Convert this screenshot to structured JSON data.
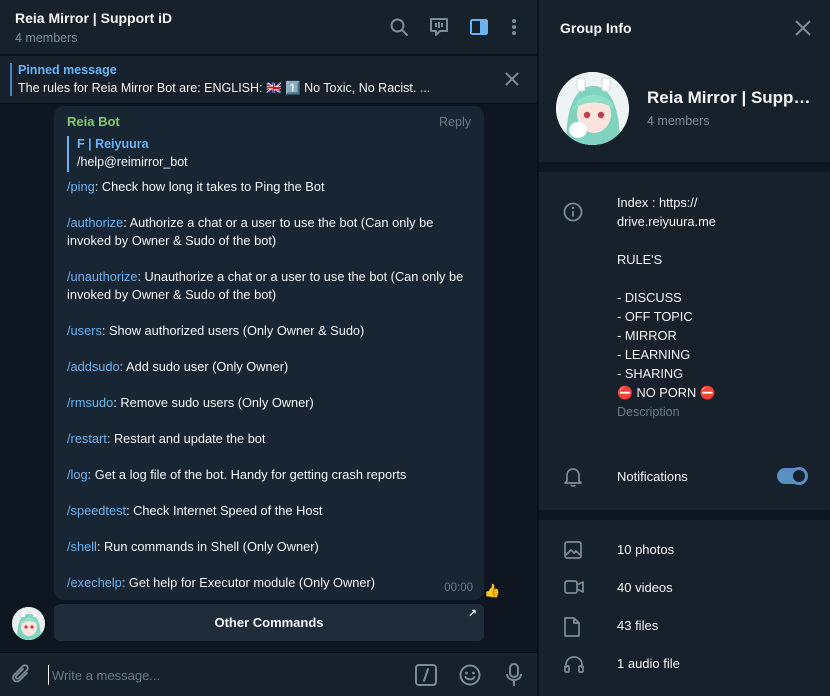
{
  "chat": {
    "title": "Reia Mirror | Support iD",
    "subtitle": "4 members",
    "header_icons": [
      "search-icon",
      "video-chat-icon",
      "sidebar-toggle-icon",
      "more-vert-icon"
    ]
  },
  "pinned": {
    "title": "Pinned message",
    "text": "The rules for Reia Mirror Bot are:  ENGLISH: 🇬🇧  1️⃣ No Toxic, No Racist.  ..."
  },
  "message": {
    "sender": "Reia Bot",
    "reply_label": "Reply",
    "quote_name": "F | Reiyuura",
    "quote_text": "/help@reimirror_bot",
    "commands": [
      {
        "cmd": "/ping",
        "desc": ": Check how long it takes to Ping the Bot"
      },
      {
        "cmd": "/authorize",
        "desc": ": Authorize a chat or a user to use the bot (Can only be invoked by Owner & Sudo of the bot)"
      },
      {
        "cmd": "/unauthorize",
        "desc": ": Unauthorize a chat or a user to use the bot (Can only be invoked by Owner & Sudo of the bot)"
      },
      {
        "cmd": "/users",
        "desc": ": Show authorized users (Only Owner & Sudo)"
      },
      {
        "cmd": "/addsudo",
        "desc": ": Add sudo user (Only Owner)"
      },
      {
        "cmd": "/rmsudo",
        "desc": ": Remove sudo users (Only Owner)"
      },
      {
        "cmd": "/restart",
        "desc": ": Restart and update the bot"
      },
      {
        "cmd": "/log",
        "desc": ": Get a log file of the bot. Handy for getting crash reports"
      },
      {
        "cmd": "/speedtest",
        "desc": ": Check Internet Speed of the Host"
      },
      {
        "cmd": "/shell",
        "desc": ": Run commands in Shell (Only Owner)"
      },
      {
        "cmd": "/exechelp",
        "desc": ": Get help for Executor module (Only Owner)"
      }
    ],
    "time": "00:00",
    "reaction": "👍",
    "button_label": "Other Commands",
    "button_arrow": "↗"
  },
  "composer": {
    "placeholder": "Write a message..."
  },
  "info": {
    "title": "Group Info",
    "group_name": "Reia Mirror | Support iD",
    "members": "4 members",
    "description_lines": [
      "Index : https://",
      "drive.reiyuura.me",
      "",
      "RULE'S",
      "",
      "- DISCUSS",
      "- OFF TOPIC",
      "- MIRROR",
      "- LEARNING",
      "- SHARING",
      " ⛔ NO PORN ⛔"
    ],
    "description_label": "Description",
    "notifications_label": "Notifications",
    "notifications_on": true,
    "media": [
      {
        "icon": "photo-icon",
        "label": "10 photos"
      },
      {
        "icon": "video-icon",
        "label": "40 videos"
      },
      {
        "icon": "file-icon",
        "label": "43 files"
      },
      {
        "icon": "headphones-icon",
        "label": "1 audio file"
      }
    ]
  },
  "colors": {
    "accent": "#6ab3f3",
    "sender_name": "#86c76b",
    "bubble": "#182533",
    "panel": "#17212b",
    "background": "#0e1621"
  }
}
